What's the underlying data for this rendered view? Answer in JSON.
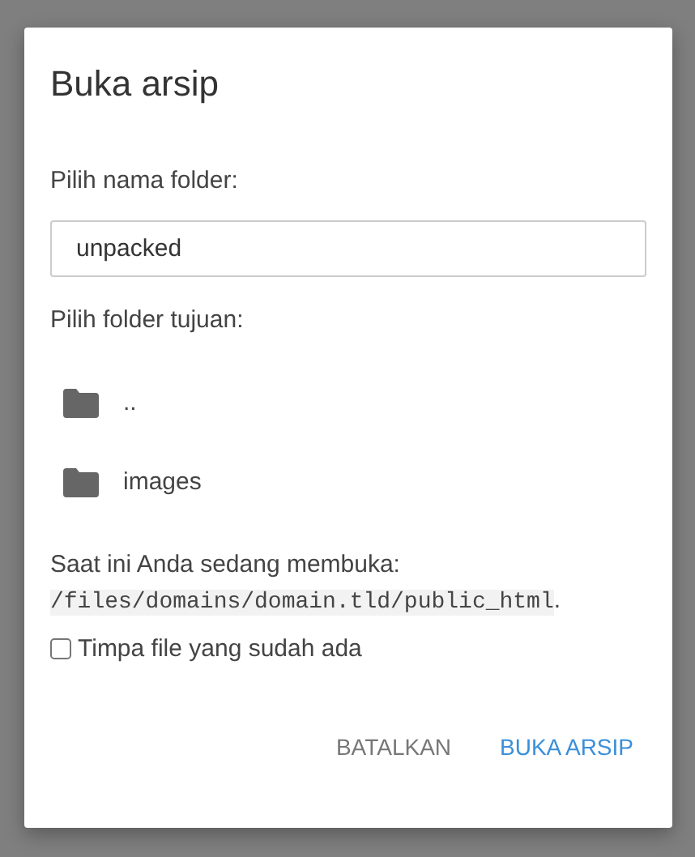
{
  "dialog": {
    "title": "Buka arsip",
    "folder_name": {
      "label": "Pilih nama folder:",
      "value": "unpacked"
    },
    "destination": {
      "label": "Pilih folder tujuan:",
      "folders": [
        {
          "name": ".."
        },
        {
          "name": "images"
        }
      ]
    },
    "current_location": {
      "text": "Saat ini Anda sedang membuka:",
      "path": "/files/domains/domain.tld/public_html",
      "suffix": "."
    },
    "overwrite": {
      "label": "Timpa file yang sudah ada",
      "checked": false
    },
    "buttons": [
      {
        "label": "BATALKAN",
        "kind": "cancel"
      },
      {
        "label": "BUKA ARSIP",
        "kind": "primary"
      }
    ]
  }
}
